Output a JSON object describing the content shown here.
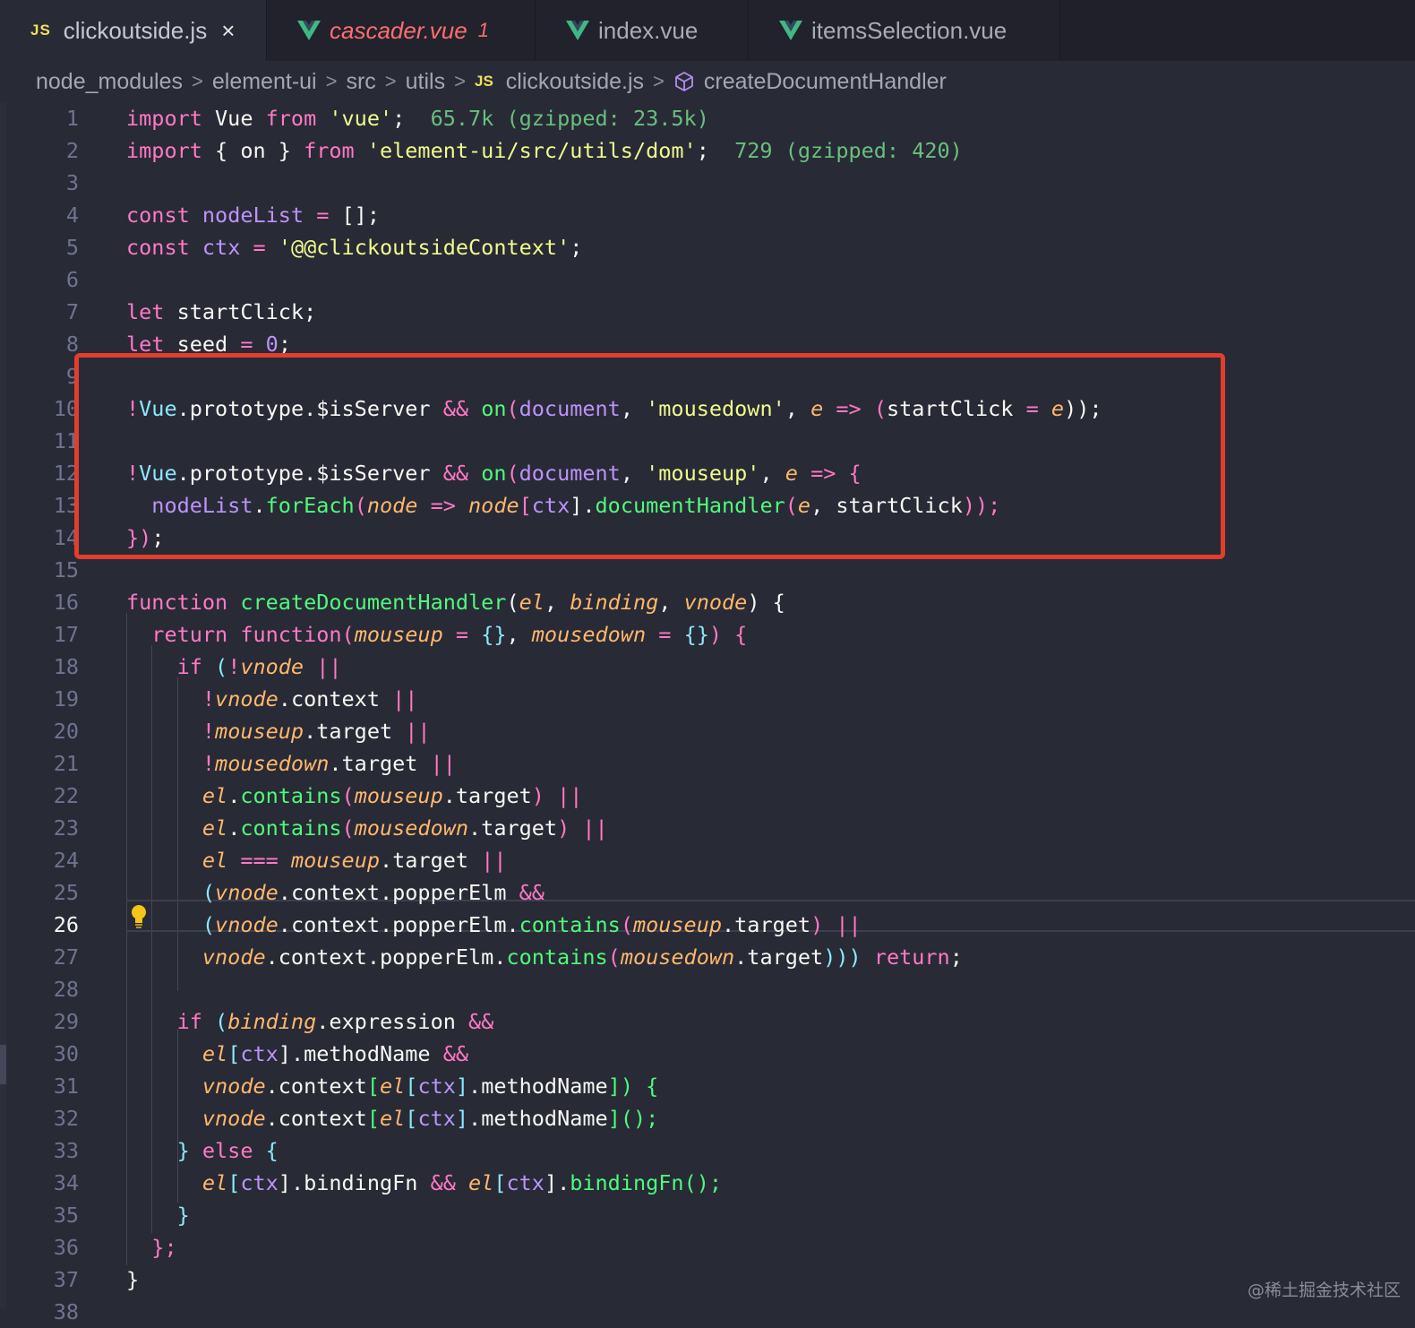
{
  "tabs": [
    {
      "label": "clickoutside.js",
      "icon": "JS",
      "active": true,
      "close": "×"
    },
    {
      "label": "cascader.vue",
      "badge": "1",
      "modified_error": true
    },
    {
      "label": "index.vue"
    },
    {
      "label": "itemsSelection.vue"
    }
  ],
  "breadcrumb": {
    "items": [
      "node_modules",
      "element-ui",
      "src",
      "utils",
      "clickoutside.js",
      "createDocumentHandler"
    ],
    "separator": ">",
    "js_icon": "JS"
  },
  "line_numbers": [
    "1",
    "2",
    "3",
    "4",
    "5",
    "6",
    "7",
    "8",
    "9",
    "10",
    "11",
    "12",
    "13",
    "14",
    "15",
    "16",
    "17",
    "18",
    "19",
    "20",
    "21",
    "22",
    "23",
    "24",
    "25",
    "26",
    "27",
    "28",
    "29",
    "30",
    "31",
    "32",
    "33",
    "34",
    "35",
    "36",
    "37",
    "38"
  ],
  "current_line": "26",
  "import_costs": {
    "vue": "65.7k (gzipped: 23.5k)",
    "dom": "729 (gzipped: 420)"
  },
  "code_lines": {
    "l1": {
      "t1": "import",
      "t2": " Vue ",
      "t3": "from",
      "t4": " ",
      "t5": "'vue'",
      "t6": ";"
    },
    "l2": {
      "t1": "import",
      "t2": " { on } ",
      "t3": "from",
      "t4": " ",
      "t5": "'element-ui/src/utils/dom'",
      "t6": ";"
    },
    "l4": {
      "t1": "const",
      "t2": " nodeList ",
      "t3": "=",
      "t4": " [];"
    },
    "l5": {
      "t1": "const",
      "t2": " ctx ",
      "t3": "=",
      "t4": " ",
      "t5": "'@@clickoutsideContext'",
      "t6": ";"
    },
    "l7": {
      "t1": "let",
      "t2": " startClick;"
    },
    "l8": {
      "t1": "let",
      "t2": " seed ",
      "t3": "=",
      "t4": " ",
      "t5": "0",
      "t6": ";"
    },
    "l10": {
      "t1": "!",
      "t2": "Vue",
      "t3": ".prototype.$isServer ",
      "t4": "&&",
      "t5": " ",
      "t6": "on",
      "t7": "(",
      "t8": "document",
      ",": ", ",
      "t9": "'mousedown'",
      "t10": ", ",
      "t11": "e",
      "t12": " => ",
      "t13": "(",
      "t14": "startClick ",
      "t15": "=",
      "t16": " ",
      "t17": "e",
      "t18": "));"
    },
    "l12": {
      "t1": "!",
      "t2": "Vue",
      "t3": ".prototype.$isServer ",
      "t4": "&&",
      "t5": " ",
      "t6": "on",
      "t7": "(",
      "t8": "document",
      "t9": ", ",
      "t10": "'mouseup'",
      "t11": ", ",
      "t12": "e",
      "t13": " => ",
      "t14": "{"
    },
    "l13": {
      "t1": "nodeList",
      "t2": ".",
      "t3": "forEach",
      "t4": "(",
      "t5": "node",
      "t6": " => ",
      "t7": "node",
      "t8": "[",
      "t9": "ctx",
      "t10": "].",
      "t11": "documentHandler",
      "t12": "(",
      "t13": "e",
      ",": ", ",
      "t14": "startClick",
      "t15": "));"
    },
    "l14": {
      "t1": "})",
      ";": ";"
    },
    "l16": {
      "t1": "function",
      "t2": " ",
      "t3": "createDocumentHandler",
      "t4": "(",
      "t5": "el",
      ",": ", ",
      "t6": "binding",
      "t7": ", ",
      "t8": "vnode",
      "t9": ") {"
    },
    "l17": {
      "t1": "return",
      "t2": " ",
      "t3": "function",
      "t4": "(",
      "t5": "mouseup",
      "t6": " = ",
      "t7": "{}",
      ",": ", ",
      "t8": "mousedown",
      "t9": " = ",
      "t10": "{}",
      "t11": ") {"
    },
    "l18": {
      "t1": "if",
      "t2": " (",
      "t3": "!",
      "t4": "vnode",
      "t5": " ||"
    },
    "l19": {
      "t1": "!",
      "t2": "vnode",
      "t3": ".context ",
      "t4": "||"
    },
    "l20": {
      "t1": "!",
      "t2": "mouseup",
      "t3": ".target ",
      "t4": "||"
    },
    "l21": {
      "t1": "!",
      "t2": "mousedown",
      "t3": ".target ",
      "t4": "||"
    },
    "l22": {
      "t1": "el",
      "t2": ".",
      "t3": "contains",
      "t4": "(",
      "t5": "mouseup",
      "t6": ".target",
      "t7": ") ",
      "t8": "||"
    },
    "l23": {
      "t1": "el",
      "t2": ".",
      "t3": "contains",
      "t4": "(",
      "t5": "mousedown",
      "t6": ".target",
      "t7": ") ",
      "t8": "||"
    },
    "l24": {
      "t1": "el",
      "t2": " ",
      "t3": "===",
      "t4": " ",
      "t5": "mouseup",
      "t6": ".target ",
      "t7": "||"
    },
    "l25": {
      "t1": "(",
      "t2": "vnode",
      "t3": ".context.popperElm ",
      "t4": "&&"
    },
    "l26": {
      "t1": "(",
      "t2": "vnode",
      "t3": ".context.popperElm.",
      "t4": "contains",
      "t5": "(",
      "t6": "mouseup",
      "t7": ".target",
      "t8": ") ",
      "t9": "||"
    },
    "l27": {
      "t1": "vnode",
      "t2": ".context.popperElm.",
      "t3": "contains",
      "t4": "(",
      "t5": "mousedown",
      "t6": ".target",
      "t7": ")))",
      "t8": " ",
      "t9": "return",
      "t10": ";"
    },
    "l29": {
      "t1": "if",
      "t2": " (",
      "t3": "binding",
      "t4": ".expression ",
      "t5": "&&"
    },
    "l30": {
      "t1": "el",
      "t2": "[",
      "t3": "ctx",
      "t4": "].methodName ",
      "t5": "&&"
    },
    "l31": {
      "t1": "vnode",
      "t2": ".context",
      "t3": "[",
      "t4": "el",
      "t5": "[",
      "t6": "ctx",
      "t7": "]",
      "t8": ".methodName",
      "t9": "]) {"
    },
    "l32": {
      "t1": "vnode",
      "t2": ".context",
      "t3": "[",
      "t4": "el",
      "t5": "[",
      "t6": "ctx",
      "t7": "]",
      "t8": ".methodName",
      "t9": "]();"
    },
    "l33": {
      "t1": "} ",
      "t2": "else",
      "t3": " {"
    },
    "l34": {
      "t1": "el",
      "t2": "[",
      "t3": "ctx",
      "t4": "].bindingFn ",
      "t5": "&&",
      "t6": " ",
      "t7": "el",
      "t8": "[",
      "t9": "ctx",
      "t10": "].",
      "t11": "bindingFn",
      "t12": "();"
    },
    "l35": {
      "t1": "}"
    },
    "l36": {
      "t1": "};"
    },
    "l37": {
      "t1": "}"
    }
  },
  "watermark": "@稀土掘金技术社区"
}
